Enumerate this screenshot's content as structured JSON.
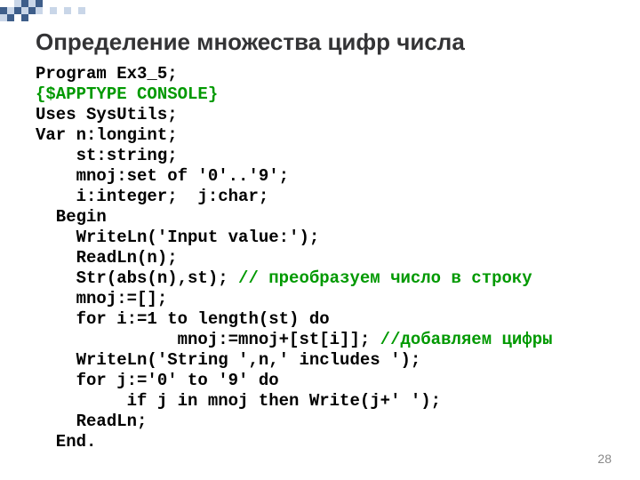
{
  "title": "Определение множества цифр числа",
  "pagenum": "28",
  "code": {
    "l1": "Program Ex3_5;",
    "l2": "{$APPTYPE CONSOLE}",
    "l3": "Uses SysUtils;",
    "l4": "Var n:longint;",
    "l5": "    st:string;",
    "l6": "    mnoj:set of '0'..'9';",
    "l7": "    i:integer;  j:char;",
    "l8": "  Begin",
    "l9": "    WriteLn('Input value:');",
    "l10": "    ReadLn(n);",
    "l11a": "    Str(abs(n),st); ",
    "l11b": "// преобразуем число в строку",
    "l12": "    mnoj:=[];",
    "l13": "    for i:=1 to length(st) do",
    "l14a": "              mnoj:=mnoj+[st[i]]; ",
    "l14b": "//добавляем цифры",
    "l15": "    WriteLn('String ',n,' includes ');",
    "l16": "    for j:='0' to '9' do",
    "l17": "         if j in mnoj then Write(j+' ');",
    "l18": "    ReadLn;",
    "l19": "  End."
  }
}
